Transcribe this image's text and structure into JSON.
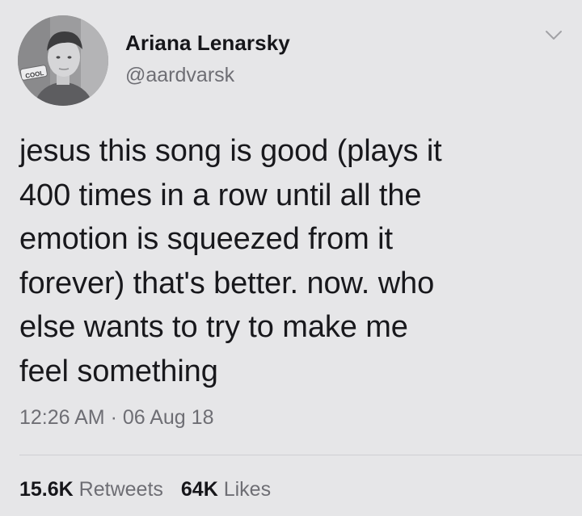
{
  "author": {
    "name": "Ariana Lenarsky",
    "handle": "@aardvarsk",
    "avatar_badge": "COOL"
  },
  "tweet": {
    "text": "jesus this song is good (plays it\n400 times in a row until all the\nemotion is squeezed from it\nforever) that's better. now. who\nelse wants to try to make me\nfeel something",
    "time": "12:26 AM",
    "separator": " · ",
    "date": "06 Aug 18"
  },
  "stats": {
    "retweets_count": "15.6K",
    "retweets_label": "Retweets",
    "likes_count": "64K",
    "likes_label": "Likes"
  },
  "icons": {
    "menu": "chevron-down-icon"
  },
  "colors": {
    "background": "#e6e6e8",
    "text": "#18181c",
    "secondary_text": "#6e6e74",
    "divider": "#cfcfd3"
  }
}
